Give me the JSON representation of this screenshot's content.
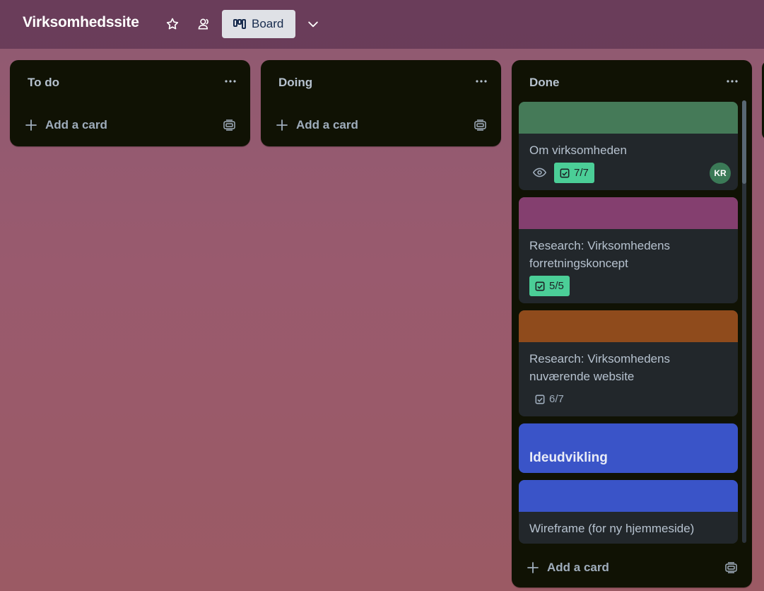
{
  "board": {
    "title": "Virksomhedssite",
    "view_label": "Board"
  },
  "icons": {
    "star": "star-icon",
    "members": "people-icon",
    "board_view": "board-columns-icon",
    "view_switch": "chevron-down-icon",
    "list_menu": "more-horizontal-icon",
    "add": "plus-icon",
    "template": "card-template-icon",
    "watch": "eye-icon",
    "checklist": "checkbox-icon"
  },
  "lists": [
    {
      "title": "To do",
      "add_label": "Add a card",
      "cards": []
    },
    {
      "title": "Doing",
      "add_label": "Add a card",
      "cards": []
    },
    {
      "title": "Done",
      "add_label": "Add a card",
      "cards": [
        {
          "title": "Om virksomheden",
          "cover_color": "#457a58",
          "watching": true,
          "checklist": "7/7",
          "checklist_complete": true,
          "member_initials": "KR"
        },
        {
          "title": "Research: Virksomhedens forretningskoncept",
          "cover_color": "#843f6f",
          "checklist": "5/5",
          "checklist_complete": true
        },
        {
          "title": "Research: Virksomhedens nuværende website",
          "cover_color": "#8f4b1c",
          "checklist": "6/7",
          "checklist_complete": false
        },
        {
          "title": "Ideudvikling",
          "cover_color": "#3a54c8",
          "full_cover": true
        },
        {
          "title": "Wireframe (for ny hjemmeside)",
          "cover_color": "#3a54c8"
        }
      ]
    }
  ],
  "colors": {
    "list_bg": "#101204",
    "card_bg": "#22272b",
    "check_complete": "#4bce97",
    "text": "#b6c2cf"
  }
}
